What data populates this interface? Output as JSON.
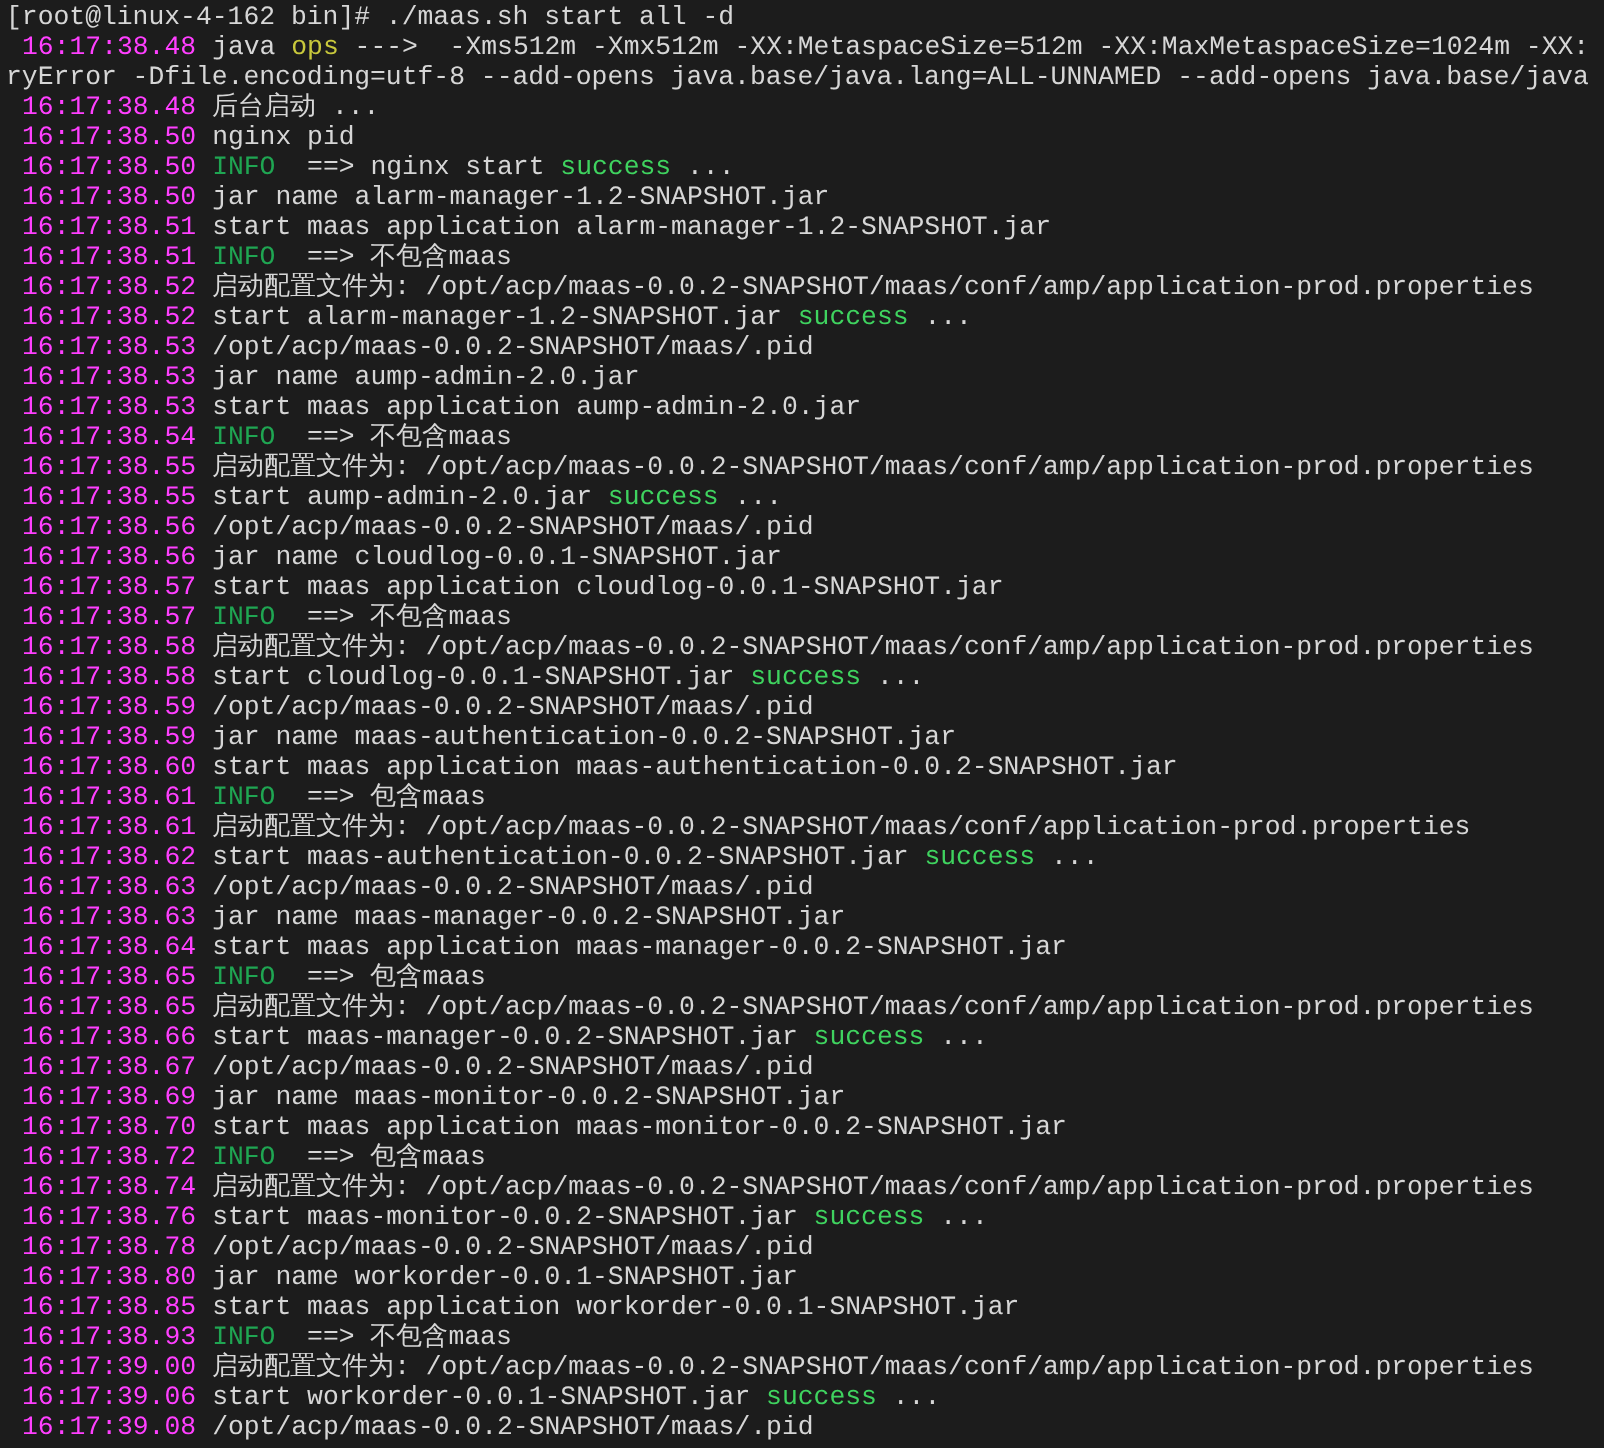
{
  "prompt": "[root@linux-4-162 bin]# ./maas.sh start all -d",
  "lines": [
    {
      "time": "16:17:38.48",
      "segments": [
        {
          "kind": "plain",
          "text": "java "
        },
        {
          "kind": "ops",
          "text": "ops"
        },
        {
          "kind": "plain",
          "text": " --->  -Xms512m -Xmx512m -XX:MetaspaceSize=512m -XX:MaxMetaspaceSize=1024m -XX:"
        }
      ]
    },
    {
      "segments": [
        {
          "kind": "plain",
          "text": "ryError -Dfile.encoding=utf-8 --add-opens java.base/java.lang=ALL-UNNAMED --add-opens java.base/java"
        }
      ]
    },
    {
      "time": "16:17:38.48",
      "segments": [
        {
          "kind": "plain",
          "text": "后台启动 ..."
        }
      ]
    },
    {
      "time": "16:17:38.50",
      "segments": [
        {
          "kind": "plain",
          "text": "nginx pid"
        }
      ]
    },
    {
      "time": "16:17:38.50",
      "segments": [
        {
          "kind": "info",
          "text": "INFO"
        },
        {
          "kind": "plain",
          "text": "  ==> nginx start "
        },
        {
          "kind": "success",
          "text": "success"
        },
        {
          "kind": "plain",
          "text": " ..."
        }
      ]
    },
    {
      "time": "16:17:38.50",
      "segments": [
        {
          "kind": "plain",
          "text": "jar name alarm-manager-1.2-SNAPSHOT.jar"
        }
      ]
    },
    {
      "time": "16:17:38.51",
      "segments": [
        {
          "kind": "plain",
          "text": "start maas application alarm-manager-1.2-SNAPSHOT.jar"
        }
      ]
    },
    {
      "time": "16:17:38.51",
      "segments": [
        {
          "kind": "info",
          "text": "INFO"
        },
        {
          "kind": "plain",
          "text": "  ==> 不包含maas"
        }
      ]
    },
    {
      "time": "16:17:38.52",
      "segments": [
        {
          "kind": "plain",
          "text": "启动配置文件为: /opt/acp/maas-0.0.2-SNAPSHOT/maas/conf/amp/application-prod.properties"
        }
      ]
    },
    {
      "time": "16:17:38.52",
      "segments": [
        {
          "kind": "plain",
          "text": "start alarm-manager-1.2-SNAPSHOT.jar "
        },
        {
          "kind": "success",
          "text": "success"
        },
        {
          "kind": "plain",
          "text": " ..."
        }
      ]
    },
    {
      "time": "16:17:38.53",
      "segments": [
        {
          "kind": "plain",
          "text": "/opt/acp/maas-0.0.2-SNAPSHOT/maas/.pid"
        }
      ]
    },
    {
      "time": "16:17:38.53",
      "segments": [
        {
          "kind": "plain",
          "text": "jar name aump-admin-2.0.jar"
        }
      ]
    },
    {
      "time": "16:17:38.53",
      "segments": [
        {
          "kind": "plain",
          "text": "start maas application aump-admin-2.0.jar"
        }
      ]
    },
    {
      "time": "16:17:38.54",
      "segments": [
        {
          "kind": "info",
          "text": "INFO"
        },
        {
          "kind": "plain",
          "text": "  ==> 不包含maas"
        }
      ]
    },
    {
      "time": "16:17:38.55",
      "segments": [
        {
          "kind": "plain",
          "text": "启动配置文件为: /opt/acp/maas-0.0.2-SNAPSHOT/maas/conf/amp/application-prod.properties"
        }
      ]
    },
    {
      "time": "16:17:38.55",
      "segments": [
        {
          "kind": "plain",
          "text": "start aump-admin-2.0.jar "
        },
        {
          "kind": "success",
          "text": "success"
        },
        {
          "kind": "plain",
          "text": " ..."
        }
      ]
    },
    {
      "time": "16:17:38.56",
      "segments": [
        {
          "kind": "plain",
          "text": "/opt/acp/maas-0.0.2-SNAPSHOT/maas/.pid"
        }
      ]
    },
    {
      "time": "16:17:38.56",
      "segments": [
        {
          "kind": "plain",
          "text": "jar name cloudlog-0.0.1-SNAPSHOT.jar"
        }
      ]
    },
    {
      "time": "16:17:38.57",
      "segments": [
        {
          "kind": "plain",
          "text": "start maas application cloudlog-0.0.1-SNAPSHOT.jar"
        }
      ]
    },
    {
      "time": "16:17:38.57",
      "segments": [
        {
          "kind": "info",
          "text": "INFO"
        },
        {
          "kind": "plain",
          "text": "  ==> 不包含maas"
        }
      ]
    },
    {
      "time": "16:17:38.58",
      "segments": [
        {
          "kind": "plain",
          "text": "启动配置文件为: /opt/acp/maas-0.0.2-SNAPSHOT/maas/conf/amp/application-prod.properties"
        }
      ]
    },
    {
      "time": "16:17:38.58",
      "segments": [
        {
          "kind": "plain",
          "text": "start cloudlog-0.0.1-SNAPSHOT.jar "
        },
        {
          "kind": "success",
          "text": "success"
        },
        {
          "kind": "plain",
          "text": " ..."
        }
      ]
    },
    {
      "time": "16:17:38.59",
      "segments": [
        {
          "kind": "plain",
          "text": "/opt/acp/maas-0.0.2-SNAPSHOT/maas/.pid"
        }
      ]
    },
    {
      "time": "16:17:38.59",
      "segments": [
        {
          "kind": "plain",
          "text": "jar name maas-authentication-0.0.2-SNAPSHOT.jar"
        }
      ]
    },
    {
      "time": "16:17:38.60",
      "segments": [
        {
          "kind": "plain",
          "text": "start maas application maas-authentication-0.0.2-SNAPSHOT.jar"
        }
      ]
    },
    {
      "time": "16:17:38.61",
      "segments": [
        {
          "kind": "info",
          "text": "INFO"
        },
        {
          "kind": "plain",
          "text": "  ==> 包含maas"
        }
      ]
    },
    {
      "time": "16:17:38.61",
      "segments": [
        {
          "kind": "plain",
          "text": "启动配置文件为: /opt/acp/maas-0.0.2-SNAPSHOT/maas/conf/application-prod.properties"
        }
      ]
    },
    {
      "time": "16:17:38.62",
      "segments": [
        {
          "kind": "plain",
          "text": "start maas-authentication-0.0.2-SNAPSHOT.jar "
        },
        {
          "kind": "success",
          "text": "success"
        },
        {
          "kind": "plain",
          "text": " ..."
        }
      ]
    },
    {
      "time": "16:17:38.63",
      "segments": [
        {
          "kind": "plain",
          "text": "/opt/acp/maas-0.0.2-SNAPSHOT/maas/.pid"
        }
      ]
    },
    {
      "time": "16:17:38.63",
      "segments": [
        {
          "kind": "plain",
          "text": "jar name maas-manager-0.0.2-SNAPSHOT.jar"
        }
      ]
    },
    {
      "time": "16:17:38.64",
      "segments": [
        {
          "kind": "plain",
          "text": "start maas application maas-manager-0.0.2-SNAPSHOT.jar"
        }
      ]
    },
    {
      "time": "16:17:38.65",
      "segments": [
        {
          "kind": "info",
          "text": "INFO"
        },
        {
          "kind": "plain",
          "text": "  ==> 包含maas"
        }
      ]
    },
    {
      "time": "16:17:38.65",
      "segments": [
        {
          "kind": "plain",
          "text": "启动配置文件为: /opt/acp/maas-0.0.2-SNAPSHOT/maas/conf/amp/application-prod.properties"
        }
      ]
    },
    {
      "time": "16:17:38.66",
      "segments": [
        {
          "kind": "plain",
          "text": "start maas-manager-0.0.2-SNAPSHOT.jar "
        },
        {
          "kind": "success",
          "text": "success"
        },
        {
          "kind": "plain",
          "text": " ..."
        }
      ]
    },
    {
      "time": "16:17:38.67",
      "segments": [
        {
          "kind": "plain",
          "text": "/opt/acp/maas-0.0.2-SNAPSHOT/maas/.pid"
        }
      ]
    },
    {
      "time": "16:17:38.69",
      "segments": [
        {
          "kind": "plain",
          "text": "jar name maas-monitor-0.0.2-SNAPSHOT.jar"
        }
      ]
    },
    {
      "time": "16:17:38.70",
      "segments": [
        {
          "kind": "plain",
          "text": "start maas application maas-monitor-0.0.2-SNAPSHOT.jar"
        }
      ]
    },
    {
      "time": "16:17:38.72",
      "segments": [
        {
          "kind": "info",
          "text": "INFO"
        },
        {
          "kind": "plain",
          "text": "  ==> 包含maas"
        }
      ]
    },
    {
      "time": "16:17:38.74",
      "segments": [
        {
          "kind": "plain",
          "text": "启动配置文件为: /opt/acp/maas-0.0.2-SNAPSHOT/maas/conf/amp/application-prod.properties"
        }
      ]
    },
    {
      "time": "16:17:38.76",
      "segments": [
        {
          "kind": "plain",
          "text": "start maas-monitor-0.0.2-SNAPSHOT.jar "
        },
        {
          "kind": "success",
          "text": "success"
        },
        {
          "kind": "plain",
          "text": " ..."
        }
      ]
    },
    {
      "time": "16:17:38.78",
      "segments": [
        {
          "kind": "plain",
          "text": "/opt/acp/maas-0.0.2-SNAPSHOT/maas/.pid"
        }
      ]
    },
    {
      "time": "16:17:38.80",
      "segments": [
        {
          "kind": "plain",
          "text": "jar name workorder-0.0.1-SNAPSHOT.jar"
        }
      ]
    },
    {
      "time": "16:17:38.85",
      "segments": [
        {
          "kind": "plain",
          "text": "start maas application workorder-0.0.1-SNAPSHOT.jar"
        }
      ]
    },
    {
      "time": "16:17:38.93",
      "segments": [
        {
          "kind": "info",
          "text": "INFO"
        },
        {
          "kind": "plain",
          "text": "  ==> 不包含maas"
        }
      ]
    },
    {
      "time": "16:17:39.00",
      "segments": [
        {
          "kind": "plain",
          "text": "启动配置文件为: /opt/acp/maas-0.0.2-SNAPSHOT/maas/conf/amp/application-prod.properties"
        }
      ]
    },
    {
      "time": "16:17:39.06",
      "segments": [
        {
          "kind": "plain",
          "text": "start workorder-0.0.1-SNAPSHOT.jar "
        },
        {
          "kind": "success",
          "text": "success"
        },
        {
          "kind": "plain",
          "text": " ..."
        }
      ]
    },
    {
      "time": "16:17:39.08",
      "segments": [
        {
          "kind": "plain",
          "text": "/opt/acp/maas-0.0.2-SNAPSHOT/maas/.pid"
        }
      ]
    }
  ]
}
